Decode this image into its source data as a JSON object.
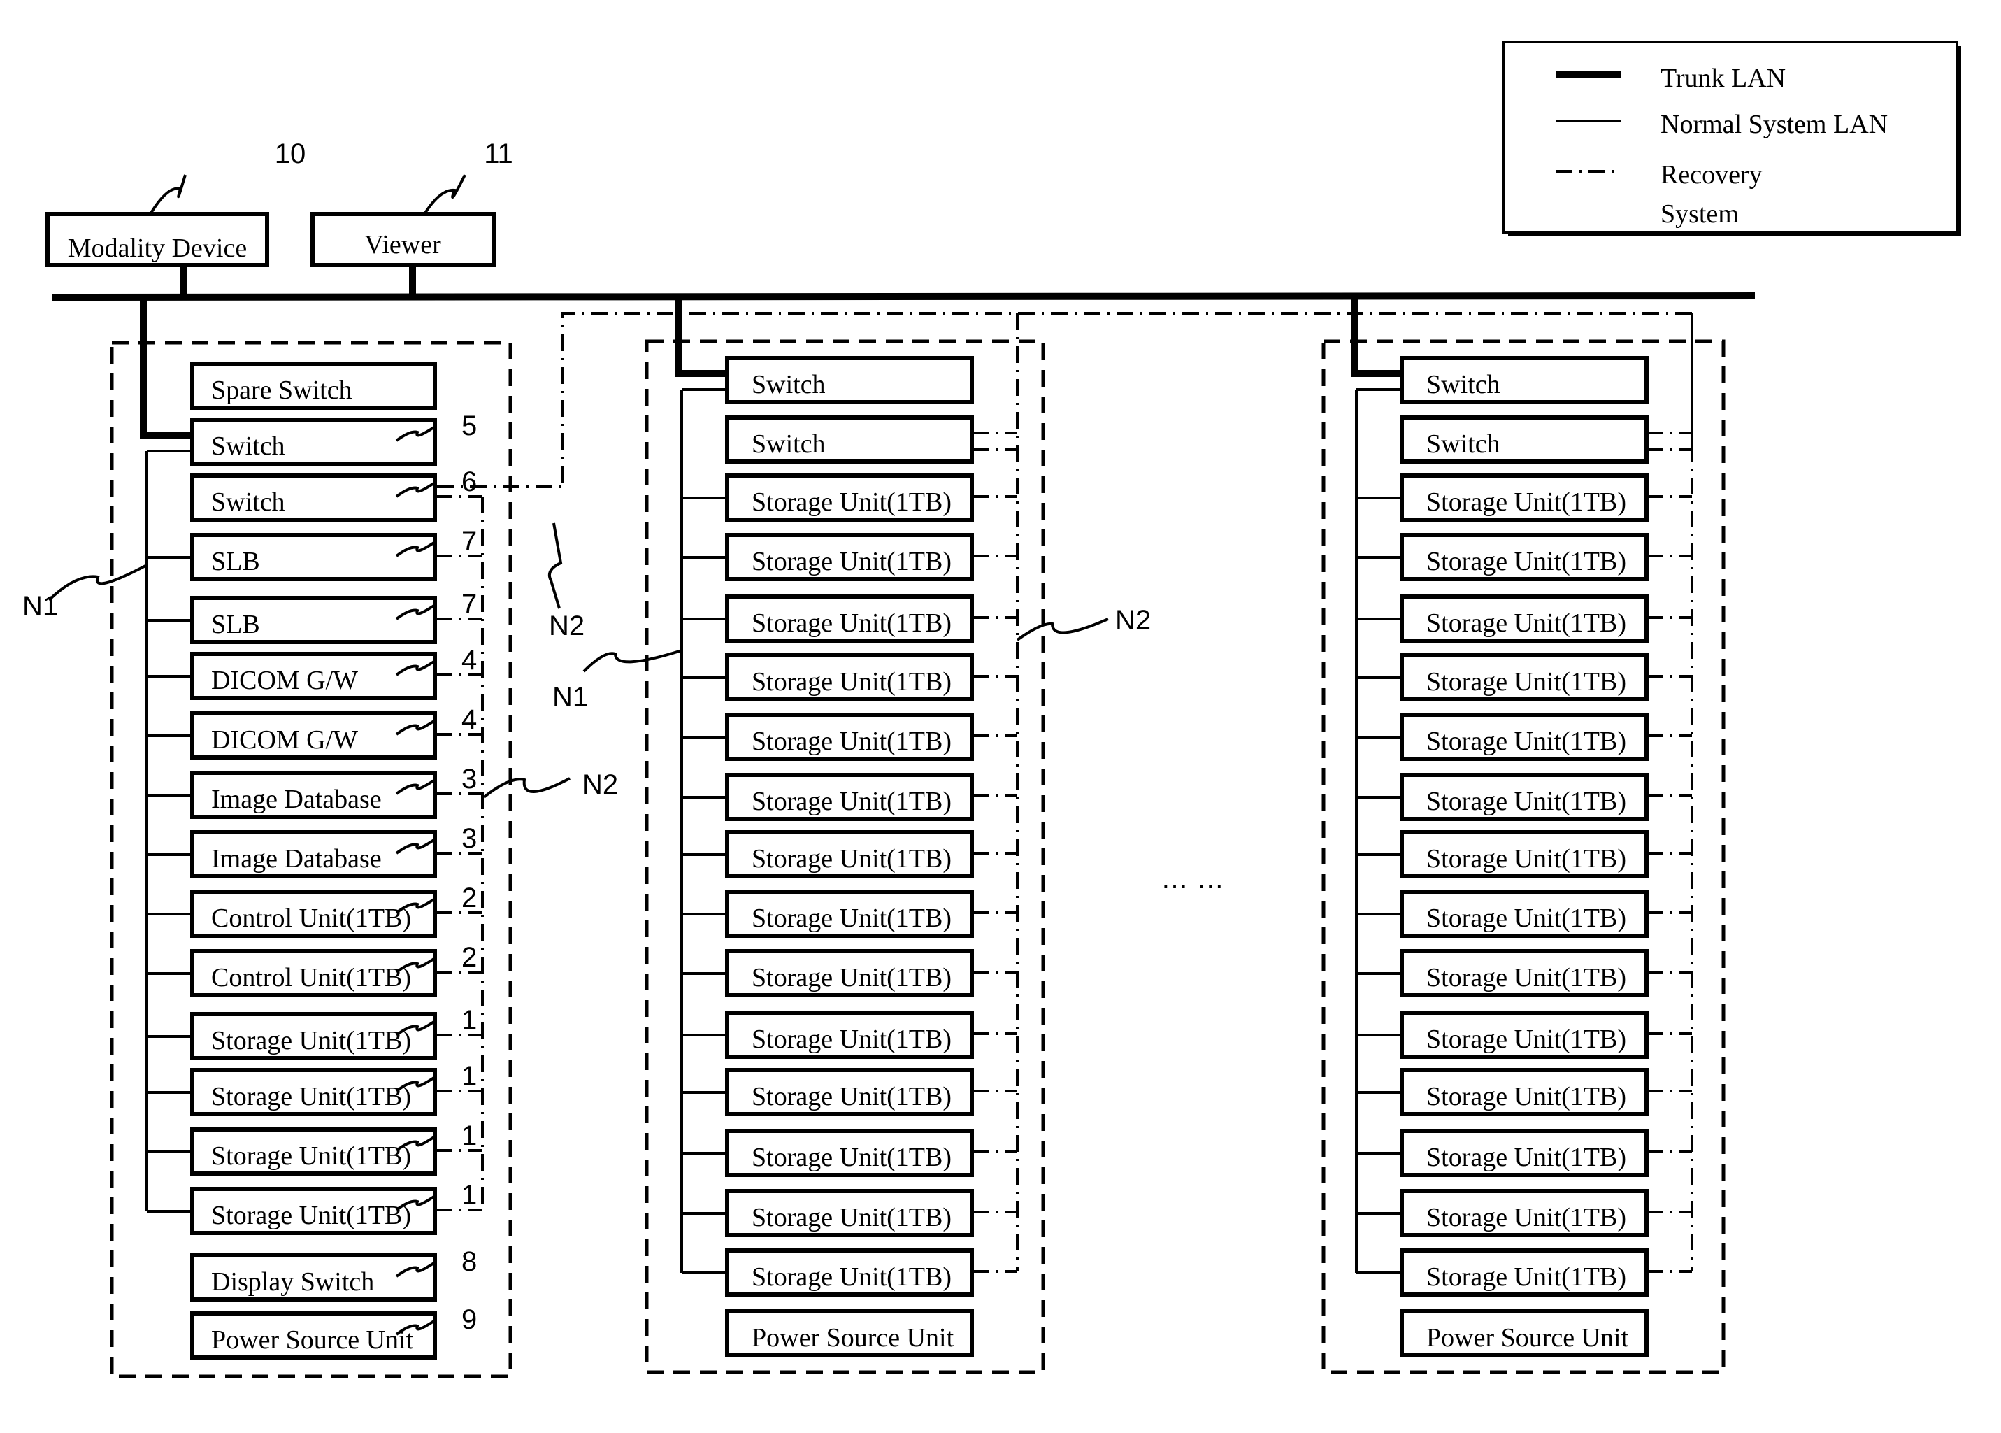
{
  "legend": {
    "items": [
      {
        "style": "trunk",
        "label": "Trunk LAN"
      },
      {
        "style": "normal",
        "label": "Normal System LAN"
      },
      {
        "style": "recovery",
        "label": "Recovery",
        "label2": "System"
      }
    ]
  },
  "devices": [
    {
      "label": "Modality Device",
      "ref": "10"
    },
    {
      "label": "Viewer",
      "ref": "11"
    }
  ],
  "network_labels": {
    "n1": "N1",
    "n2": "N2"
  },
  "ellipsis": "… …",
  "cabinets": [
    {
      "name": "cabinet-1",
      "units": [
        {
          "label": "Spare Switch",
          "ref": "",
          "normal": false,
          "recovery": false,
          "trunk": false
        },
        {
          "label": "Switch",
          "ref": "5",
          "normal": true,
          "recovery": false,
          "trunk": true
        },
        {
          "label": "Switch",
          "ref": "6",
          "normal": false,
          "recovery": true,
          "trunk": false
        },
        {
          "label": "SLB",
          "ref": "7",
          "normal": true,
          "recovery": true
        },
        {
          "label": "SLB",
          "ref": "7",
          "normal": true,
          "recovery": true
        },
        {
          "label": "DICOM G/W",
          "ref": "4",
          "normal": true,
          "recovery": true
        },
        {
          "label": "DICOM G/W",
          "ref": "4",
          "normal": true,
          "recovery": true
        },
        {
          "label": "Image Database",
          "ref": "3",
          "normal": true,
          "recovery": true
        },
        {
          "label": "Image Database",
          "ref": "3",
          "normal": true,
          "recovery": true
        },
        {
          "label": "Control Unit(1TB)",
          "ref": "2",
          "normal": true,
          "recovery": true
        },
        {
          "label": "Control Unit(1TB)",
          "ref": "2",
          "normal": true,
          "recovery": true
        },
        {
          "label": "Storage Unit(1TB)",
          "ref": "1",
          "normal": true,
          "recovery": true
        },
        {
          "label": "Storage Unit(1TB)",
          "ref": "1",
          "normal": true,
          "recovery": true
        },
        {
          "label": "Storage Unit(1TB)",
          "ref": "1",
          "normal": true,
          "recovery": true
        },
        {
          "label": "Storage Unit(1TB)",
          "ref": "1",
          "normal": true,
          "recovery": true
        },
        {
          "label": "Display Switch",
          "ref": "8",
          "normal": false,
          "recovery": false
        },
        {
          "label": "Power Source Unit",
          "ref": "9",
          "normal": false,
          "recovery": false
        }
      ]
    },
    {
      "name": "cabinet-2",
      "units": [
        {
          "label": "Switch",
          "trunk": true,
          "normal": true,
          "recovery": false
        },
        {
          "label": "Switch",
          "normal": false,
          "recovery": true,
          "double": true
        },
        {
          "label": "Storage Unit(1TB)",
          "normal": true,
          "recovery": true
        },
        {
          "label": "Storage Unit(1TB)",
          "normal": true,
          "recovery": true
        },
        {
          "label": "Storage Unit(1TB)",
          "normal": true,
          "recovery": true
        },
        {
          "label": "Storage Unit(1TB)",
          "normal": true,
          "recovery": true
        },
        {
          "label": "Storage Unit(1TB)",
          "normal": true,
          "recovery": true
        },
        {
          "label": "Storage Unit(1TB)",
          "normal": true,
          "recovery": true
        },
        {
          "label": "Storage Unit(1TB)",
          "normal": true,
          "recovery": true
        },
        {
          "label": "Storage Unit(1TB)",
          "normal": true,
          "recovery": true
        },
        {
          "label": "Storage Unit(1TB)",
          "normal": true,
          "recovery": true
        },
        {
          "label": "Storage Unit(1TB)",
          "normal": true,
          "recovery": true
        },
        {
          "label": "Storage Unit(1TB)",
          "normal": true,
          "recovery": true
        },
        {
          "label": "Storage Unit(1TB)",
          "normal": true,
          "recovery": true
        },
        {
          "label": "Storage Unit(1TB)",
          "normal": true,
          "recovery": true
        },
        {
          "label": "Storage Unit(1TB)",
          "normal": true,
          "recovery": true
        },
        {
          "label": "Power Source Unit",
          "normal": false,
          "recovery": false
        }
      ]
    },
    {
      "name": "cabinet-3",
      "units": [
        {
          "label": "Switch",
          "trunk": true,
          "normal": true,
          "recovery": false
        },
        {
          "label": "Switch",
          "normal": false,
          "recovery": true,
          "double": true
        },
        {
          "label": "Storage Unit(1TB)",
          "normal": true,
          "recovery": true
        },
        {
          "label": "Storage Unit(1TB)",
          "normal": true,
          "recovery": true
        },
        {
          "label": "Storage Unit(1TB)",
          "normal": true,
          "recovery": true
        },
        {
          "label": "Storage Unit(1TB)",
          "normal": true,
          "recovery": true
        },
        {
          "label": "Storage Unit(1TB)",
          "normal": true,
          "recovery": true
        },
        {
          "label": "Storage Unit(1TB)",
          "normal": true,
          "recovery": true
        },
        {
          "label": "Storage Unit(1TB)",
          "normal": true,
          "recovery": true
        },
        {
          "label": "Storage Unit(1TB)",
          "normal": true,
          "recovery": true
        },
        {
          "label": "Storage Unit(1TB)",
          "normal": true,
          "recovery": true
        },
        {
          "label": "Storage Unit(1TB)",
          "normal": true,
          "recovery": true
        },
        {
          "label": "Storage Unit(1TB)",
          "normal": true,
          "recovery": true
        },
        {
          "label": "Storage Unit(1TB)",
          "normal": true,
          "recovery": true
        },
        {
          "label": "Storage Unit(1TB)",
          "normal": true,
          "recovery": true
        },
        {
          "label": "Storage Unit(1TB)",
          "normal": true,
          "recovery": true
        },
        {
          "label": "Power Source Unit",
          "normal": false,
          "recovery": false
        }
      ]
    }
  ]
}
